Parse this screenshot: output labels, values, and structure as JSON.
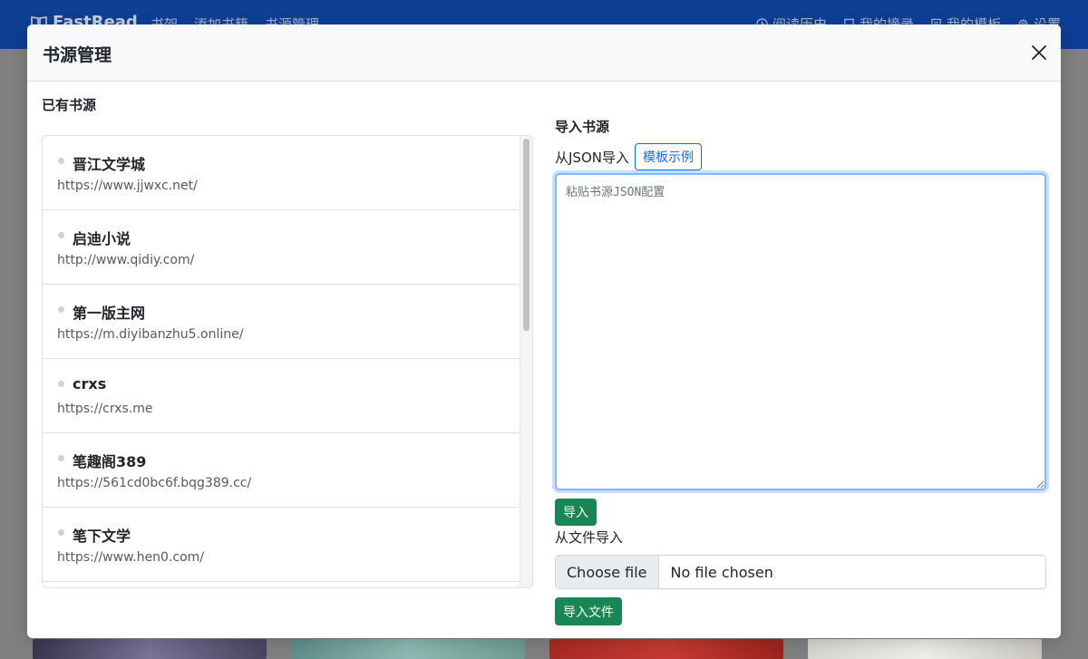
{
  "navbar": {
    "brand": "FastRead",
    "left_items": [
      "书架",
      "添加书籍",
      "书源管理"
    ],
    "right_items": [
      {
        "label": "阅读历史",
        "icon": "clock-icon"
      },
      {
        "label": "我的摘录",
        "icon": "bookmark-icon"
      },
      {
        "label": "我的模板",
        "icon": "document-icon"
      },
      {
        "label": "设置",
        "icon": "gear-icon"
      }
    ]
  },
  "modal": {
    "title": "书源管理",
    "close_icon": "close-icon",
    "existing_sources": {
      "label": "已有书源",
      "items": [
        {
          "name": "晋江文学城",
          "url": "https://www.jjwxc.net/"
        },
        {
          "name": "启迪小说",
          "url": "http://www.qidiy.com/"
        },
        {
          "name": "第一版主网",
          "url": "https://m.diyibanzhu5.online/"
        },
        {
          "name": "crxs",
          "url": "https://crxs.me"
        },
        {
          "name": "笔趣阁389",
          "url": "https://561cd0bc6f.bqg389.cc/"
        },
        {
          "name": "笔下文学",
          "url": "https://www.hen0.com/"
        }
      ]
    },
    "import": {
      "label": "导入书源",
      "json_label": "从JSON导入",
      "template_button": "模板示例",
      "textarea_placeholder": "粘贴书源JSON配置",
      "textarea_value": "",
      "import_button": "导入",
      "file_label": "从文件导入",
      "choose_file_button": "Choose file",
      "file_status": "No file chosen",
      "import_file_button": "导入文件"
    }
  },
  "colors": {
    "navbar": "#0d3f94",
    "primary": "#0d6efd",
    "success": "#198754",
    "border": "#dee2e6"
  }
}
